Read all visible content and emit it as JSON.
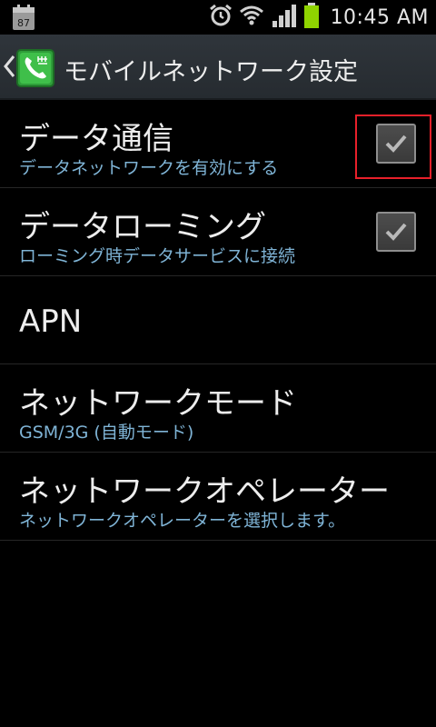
{
  "status_bar": {
    "time": "10:45 AM",
    "calendar_date": "87",
    "icons": [
      "calendar-icon",
      "alarm-icon",
      "wifi-icon",
      "signal-icon",
      "battery-icon"
    ]
  },
  "action_bar": {
    "title": "モバイルネットワーク設定",
    "back_icon": "chevron-left-icon",
    "app_icon": "phone-icon"
  },
  "rows": [
    {
      "title": "データ通信",
      "subtitle": "データネットワークを有効にする",
      "checkbox": true,
      "checked": true
    },
    {
      "title": "データローミング",
      "subtitle": "ローミング時データサービスに接続",
      "checkbox": true,
      "checked": true
    },
    {
      "title": "APN",
      "subtitle": "",
      "checkbox": false
    },
    {
      "title": "ネットワークモード",
      "subtitle": "GSM/3G (自動モード)",
      "checkbox": false
    },
    {
      "title": "ネットワークオペレーター",
      "subtitle": "ネットワークオペレーターを選択します。",
      "checkbox": false
    }
  ],
  "colors": {
    "background": "#000000",
    "action_bar": "#2b3035",
    "subtitle": "#7fb4d6",
    "highlight": "#e8202a",
    "battery": "#8fd400"
  }
}
